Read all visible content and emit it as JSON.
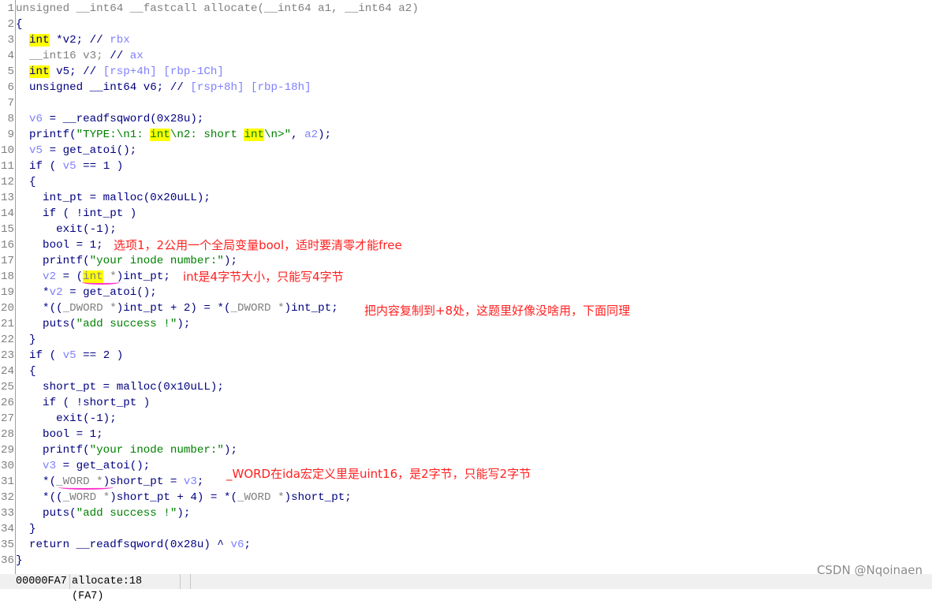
{
  "colors": {
    "keyword": "#000080",
    "type_gray": "#808080",
    "variable": "#8080ff",
    "string": "#008000",
    "highlight": "#ffff00",
    "annotation": "#ff2020",
    "underline": "#ff33cc"
  },
  "code_lines": [
    [
      [
        "g",
        "unsigned __int64 __fastcall allocate(__int64 a1, __int64 a2)"
      ]
    ],
    [
      [
        "n",
        "{"
      ]
    ],
    [
      [
        "n",
        "  "
      ],
      [
        "h",
        "int"
      ],
      [
        "n",
        " *v2; //"
      ],
      [
        "v",
        " rbx"
      ]
    ],
    [
      [
        "g",
        "  __int16 v3;"
      ],
      [
        "n",
        " //"
      ],
      [
        "v",
        " ax"
      ]
    ],
    [
      [
        "n",
        "  "
      ],
      [
        "h",
        "int"
      ],
      [
        "n",
        " v5; //"
      ],
      [
        "v",
        " [rsp+4h] [rbp-1Ch]"
      ]
    ],
    [
      [
        "n",
        "  unsigned __int64 v6; //"
      ],
      [
        "v",
        " [rsp+8h] [rbp-18h]"
      ]
    ],
    [],
    [
      [
        "v",
        "  v6"
      ],
      [
        "n",
        " = __readfsqword(0x28u);"
      ]
    ],
    [
      [
        "n",
        "  printf("
      ],
      [
        "s",
        "\"TYPE:\\n1: "
      ],
      [
        "hs",
        "int"
      ],
      [
        "s",
        "\\n2: short "
      ],
      [
        "hs",
        "int"
      ],
      [
        "s",
        "\\n>\""
      ],
      [
        "n",
        ", "
      ],
      [
        "v",
        "a2"
      ],
      [
        "n",
        ");"
      ]
    ],
    [
      [
        "v",
        "  v5"
      ],
      [
        "n",
        " = get_atoi();"
      ]
    ],
    [
      [
        "n",
        "  if ( "
      ],
      [
        "v",
        "v5"
      ],
      [
        "n",
        " == 1 )"
      ]
    ],
    [
      [
        "n",
        "  {"
      ]
    ],
    [
      [
        "n",
        "    int_pt = malloc(0x20uLL);"
      ]
    ],
    [
      [
        "n",
        "    if ( !int_pt )"
      ]
    ],
    [
      [
        "n",
        "      exit(-1);"
      ]
    ],
    [
      [
        "n",
        "    bool = 1;"
      ]
    ],
    [
      [
        "n",
        "    printf("
      ],
      [
        "s",
        "\"your inode number:\""
      ],
      [
        "n",
        ");"
      ]
    ],
    [
      [
        "v",
        "    v2"
      ],
      [
        "n",
        " = ("
      ],
      [
        "hg",
        "int"
      ],
      [
        "g",
        " *"
      ],
      [
        "n",
        ")int_pt;"
      ]
    ],
    [
      [
        "n",
        "    *"
      ],
      [
        "v",
        "v2"
      ],
      [
        "n",
        " = get_atoi();"
      ]
    ],
    [
      [
        "n",
        "    *(("
      ],
      [
        "g",
        "_DWORD *"
      ],
      [
        "n",
        ")int_pt + 2) = *("
      ],
      [
        "g",
        "_DWORD *"
      ],
      [
        "n",
        ")int_pt;"
      ]
    ],
    [
      [
        "n",
        "    puts("
      ],
      [
        "s",
        "\"add success !\""
      ],
      [
        "n",
        ");"
      ]
    ],
    [
      [
        "n",
        "  }"
      ]
    ],
    [
      [
        "n",
        "  if ( "
      ],
      [
        "v",
        "v5"
      ],
      [
        "n",
        " == 2 )"
      ]
    ],
    [
      [
        "n",
        "  {"
      ]
    ],
    [
      [
        "n",
        "    short_pt = malloc(0x10uLL);"
      ]
    ],
    [
      [
        "n",
        "    if ( !short_pt )"
      ]
    ],
    [
      [
        "n",
        "      exit(-1);"
      ]
    ],
    [
      [
        "n",
        "    bool = 1;"
      ]
    ],
    [
      [
        "n",
        "    printf("
      ],
      [
        "s",
        "\"your inode number:\""
      ],
      [
        "n",
        ");"
      ]
    ],
    [
      [
        "v",
        "    v3"
      ],
      [
        "n",
        " = get_atoi();"
      ]
    ],
    [
      [
        "n",
        "    *("
      ],
      [
        "g",
        "_WORD *"
      ],
      [
        "n",
        ")short_pt = "
      ],
      [
        "v",
        "v3"
      ],
      [
        "n",
        ";"
      ]
    ],
    [
      [
        "n",
        "    *(("
      ],
      [
        "g",
        "_WORD *"
      ],
      [
        "n",
        ")short_pt + 4) = *("
      ],
      [
        "g",
        "_WORD *"
      ],
      [
        "n",
        ")short_pt;"
      ]
    ],
    [
      [
        "n",
        "    puts("
      ],
      [
        "s",
        "\"add success !\""
      ],
      [
        "n",
        ");"
      ]
    ],
    [
      [
        "n",
        "  }"
      ]
    ],
    [
      [
        "n",
        "  return __readfsqword(0x28u) ^ "
      ],
      [
        "v",
        "v6"
      ],
      [
        "n",
        ";"
      ]
    ],
    [
      [
        "n",
        "}"
      ]
    ]
  ],
  "annotations": {
    "line16": "选项1，2公用一个全局变量bool，适时要清零才能free",
    "line18": "int是4字节大小，只能写4字节",
    "line20": "把内容复制到+8处，这题里好像没啥用，下面同理",
    "line31": "_WORD在ida宏定义里是uint16，是2字节，只能写2字节"
  },
  "status_bar": {
    "address": "00000FA7",
    "location": "allocate:18 (FA7)"
  },
  "watermark": "CSDN @Nqoinaen"
}
